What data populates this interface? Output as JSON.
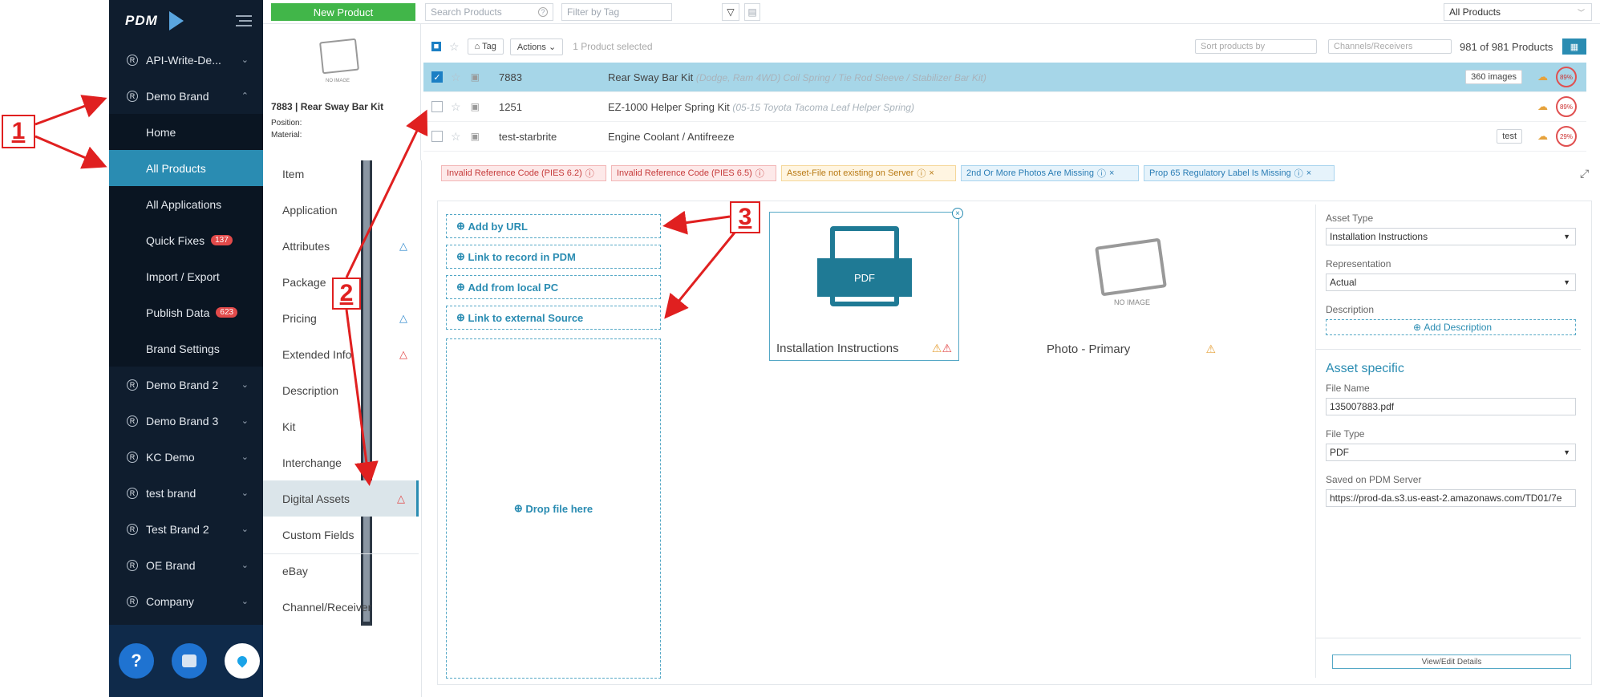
{
  "annotations": {
    "one": "1",
    "two": "2",
    "three": "3"
  },
  "sidebar": {
    "logo_text": "PDM",
    "items": [
      {
        "label": "API-Write-De...",
        "type": "brand"
      },
      {
        "label": "Demo Brand",
        "type": "brand-open"
      },
      {
        "label": "Home",
        "type": "sub"
      },
      {
        "label": "All Products",
        "type": "sub-active"
      },
      {
        "label": "All Applications",
        "type": "sub"
      },
      {
        "label": "Quick Fixes",
        "type": "sub",
        "badge": "137"
      },
      {
        "label": "Import / Export",
        "type": "sub"
      },
      {
        "label": "Publish Data",
        "type": "sub",
        "badge": "623"
      },
      {
        "label": "Brand Settings",
        "type": "sub"
      },
      {
        "label": "Demo Brand 2",
        "type": "brand"
      },
      {
        "label": "Demo Brand 3",
        "type": "brand"
      },
      {
        "label": "KC Demo",
        "type": "brand"
      },
      {
        "label": "test brand",
        "type": "brand"
      },
      {
        "label": "Test Brand 2",
        "type": "brand"
      },
      {
        "label": "OE Brand",
        "type": "brand"
      },
      {
        "label": "Company",
        "type": "brand"
      }
    ],
    "help_icon": "?"
  },
  "topbar": {
    "new_product": "New Product",
    "search_placeholder": "Search Products",
    "filter_placeholder": "Filter by Tag",
    "all_products": "All Products"
  },
  "product_summary": {
    "title": "7883 | Rear Sway Bar Kit",
    "position": "Position:",
    "material": "Material:",
    "no_image": "NO IMAGE"
  },
  "list": {
    "tag": "Tag",
    "actions": "Actions",
    "selected": "1 Product selected",
    "sort": "Sort products by",
    "channels": "Channels/Receivers",
    "count": "981 of 981 Products",
    "rows": [
      {
        "part": "7883",
        "name": "Rear Sway Bar Kit",
        "desc": "(Dodge, Ram 4WD) Coil Spring / Tie Rod Sleeve / Stabilizer Bar Kit)",
        "badge": "360 images",
        "score": "89%"
      },
      {
        "part": "1251",
        "name": "EZ-1000 Helper Spring Kit",
        "desc": "(05-15 Toyota Tacoma Leaf Helper Spring)",
        "badge": "",
        "score": "89%"
      },
      {
        "part": "test-starbrite",
        "name": "Engine Coolant / Antifreeze",
        "desc": "",
        "badge": "test",
        "score": "29%"
      }
    ]
  },
  "nav": [
    {
      "label": "Item"
    },
    {
      "label": "Application"
    },
    {
      "label": "Attributes",
      "warn": "blue"
    },
    {
      "label": "Package"
    },
    {
      "label": "Pricing",
      "warn": "blue"
    },
    {
      "label": "Extended Info",
      "warn": "red"
    },
    {
      "label": "Description"
    },
    {
      "label": "Kit"
    },
    {
      "label": "Interchange"
    },
    {
      "label": "Digital Assets",
      "warn": "red",
      "active": true
    },
    {
      "label": "Custom Fields"
    },
    {
      "label": "eBay"
    },
    {
      "label": "Channel/Receiver"
    }
  ],
  "tags": [
    {
      "label": "Invalid Reference Code (PIES 6.2)",
      "color": "red"
    },
    {
      "label": "Invalid Reference Code (PIES 6.5)",
      "color": "red"
    },
    {
      "label": "Asset-File not existing on Server",
      "color": "yellow"
    },
    {
      "label": "2nd Or More Photos Are Missing",
      "color": "blue"
    },
    {
      "label": "Prop 65 Regulatory Label Is Missing",
      "color": "blue"
    }
  ],
  "assets": {
    "add_url": "Add by URL",
    "link_pdm": "Link to record in PDM",
    "add_local": "Add from local PC",
    "link_external": "Link to external Source",
    "drop": "Drop file here",
    "pdf_label": "PDF",
    "card1": "Installation Instructions",
    "card2": "Photo - Primary",
    "no_image": "NO IMAGE"
  },
  "details": {
    "asset_type_label": "Asset Type",
    "asset_type": "Installation Instructions",
    "representation_label": "Representation",
    "representation": "Actual",
    "description_label": "Description",
    "add_description": "Add Description",
    "asset_specific": "Asset specific",
    "file_name_label": "File Name",
    "file_name": "135007883.pdf",
    "file_type_label": "File Type",
    "file_type": "PDF",
    "saved_label": "Saved on PDM Server",
    "saved_url": "https://prod-da.s3.us-east-2.amazonaws.com/TD01/7e",
    "view_edit": "View/Edit Details"
  }
}
